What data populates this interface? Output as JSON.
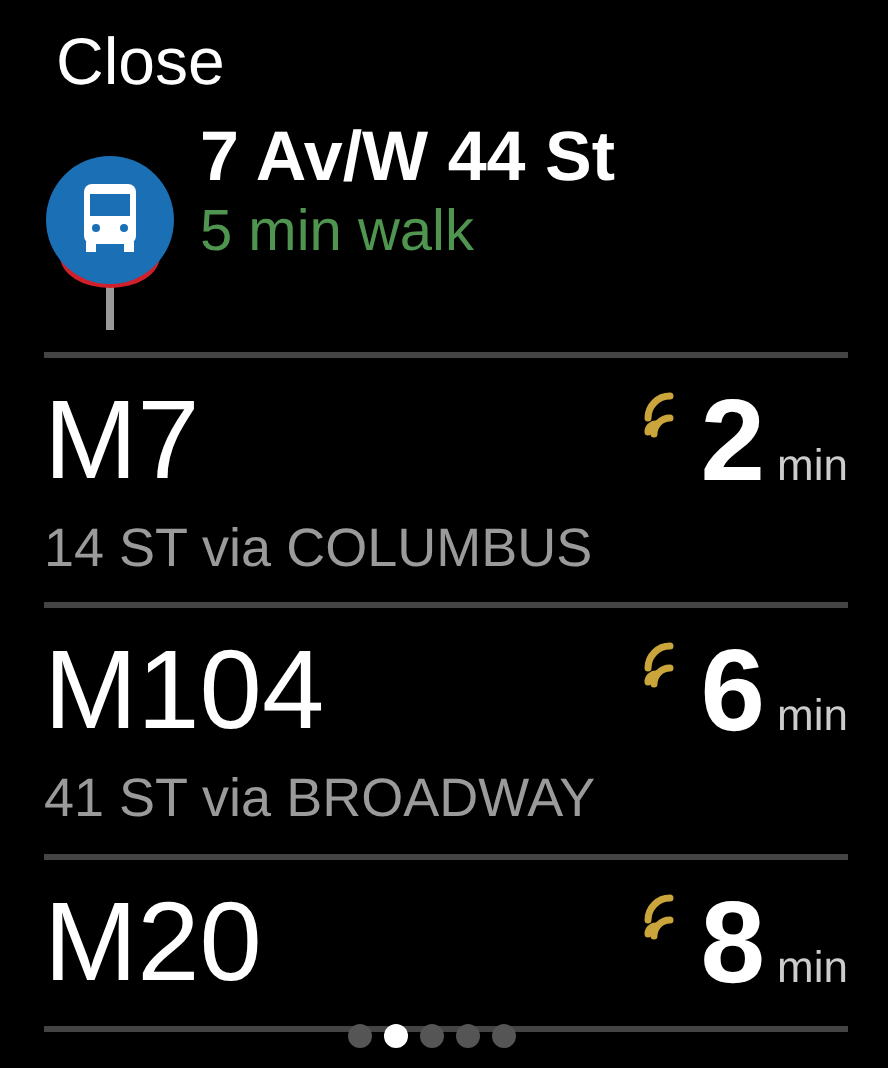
{
  "close_label": "Close",
  "stop": {
    "name": "7 Av/W 44 St",
    "walk": "5 min walk"
  },
  "routes": [
    {
      "route": "M7",
      "destination": "14 ST via COLUMBUS",
      "minutes": "2",
      "unit": "min",
      "live": true
    },
    {
      "route": "M104",
      "destination": "41 ST via BROADWAY",
      "minutes": "6",
      "unit": "min",
      "live": true
    },
    {
      "route": "M20",
      "minutes": "8",
      "unit": "min",
      "live": true
    }
  ],
  "page_dots": [
    {
      "selected": false
    },
    {
      "selected": true
    },
    {
      "selected": false
    },
    {
      "selected": false
    },
    {
      "selected": false
    }
  ]
}
